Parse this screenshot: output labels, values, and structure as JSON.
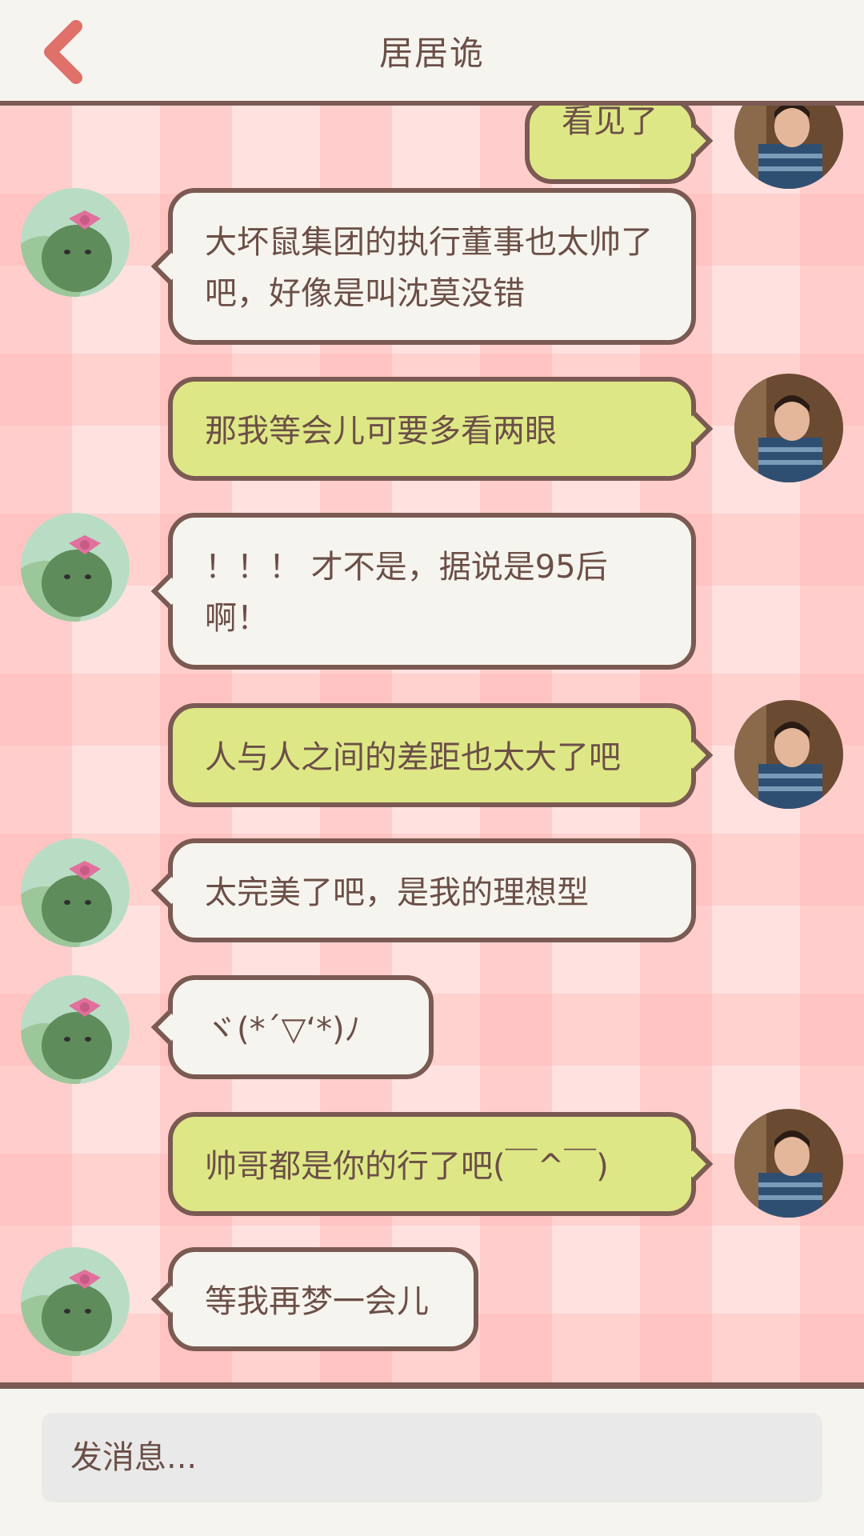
{
  "header": {
    "title": "居居诡",
    "back_icon": "chevron-left-icon",
    "accent_color": "#e0706a"
  },
  "messages": [
    {
      "side": "right",
      "text": "看见了",
      "partial": true
    },
    {
      "side": "left",
      "text": "大坏鼠集团的执行董事也太帅了吧，好像是叫沈莫没错"
    },
    {
      "side": "right",
      "text": "那我等会儿可要多看两眼"
    },
    {
      "side": "left",
      "text": "！！！ 才不是，据说是95后啊！"
    },
    {
      "side": "right",
      "text": "人与人之间的差距也太大了吧"
    },
    {
      "side": "left",
      "text": "太完美了吧，是我的理想型"
    },
    {
      "side": "left",
      "text": "ヾ(*´▽‘*)ﾉ"
    },
    {
      "side": "right",
      "text": "帅哥都是你的行了吧(￣^￣)"
    },
    {
      "side": "left",
      "text": "等我再梦一会儿"
    }
  ],
  "input": {
    "placeholder": "发消息..."
  },
  "colors": {
    "bubble_left": "#f6f4ee",
    "bubble_right": "#dee786",
    "border": "#7a5a52",
    "text": "#6b4f47",
    "chat_bg": "#ffe2df"
  }
}
